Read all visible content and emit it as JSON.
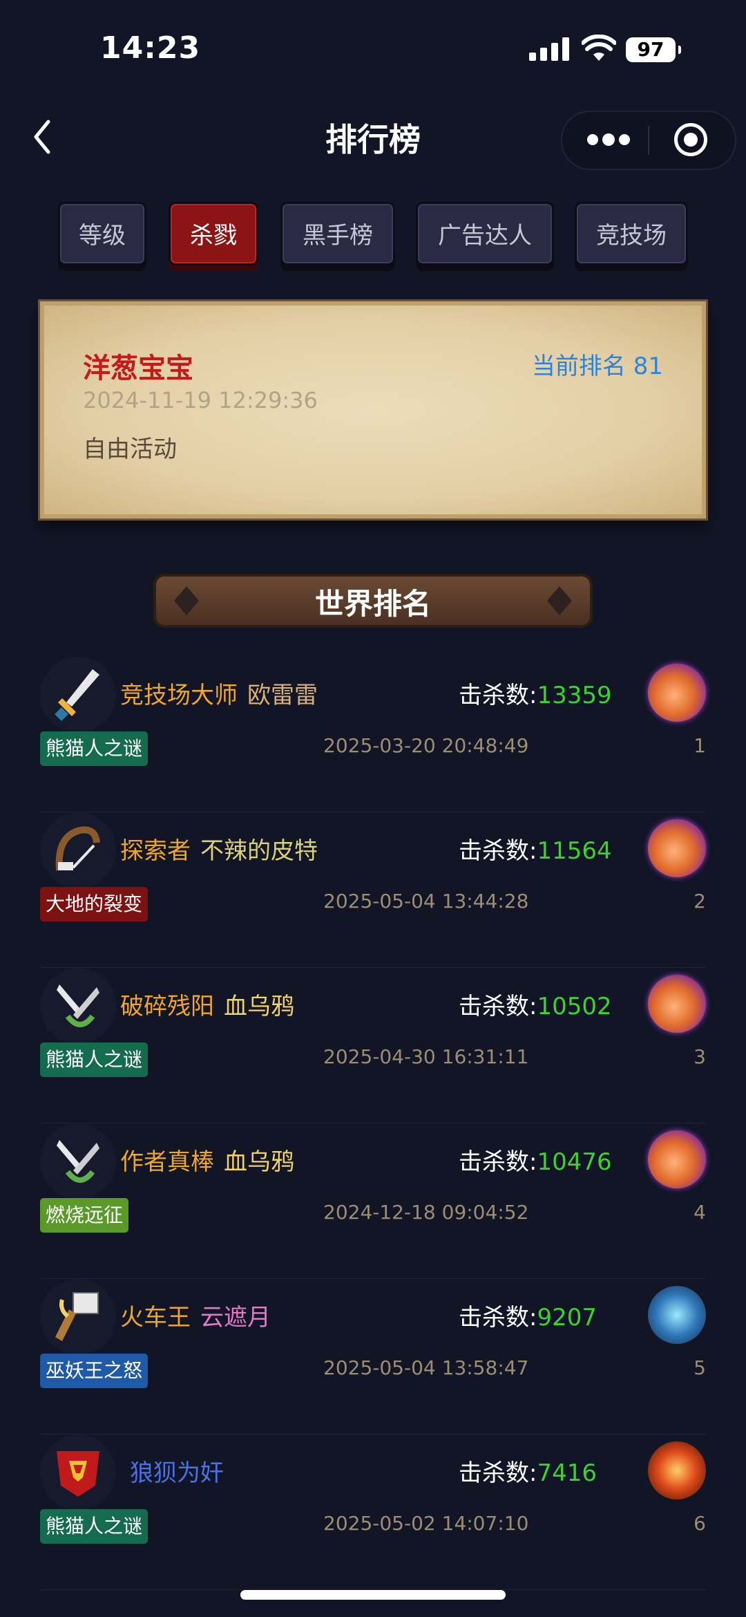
{
  "status": {
    "time": "14:23",
    "battery": "97"
  },
  "nav": {
    "title": "排行榜"
  },
  "tabs": [
    "等级",
    "杀戮",
    "黑手榜",
    "广告达人",
    "竞技场"
  ],
  "active_tab": "杀戮",
  "me": {
    "name": "洋葱宝宝",
    "rank_label": "当前排名 81",
    "time": "2024-11-19 12:29:36",
    "activity": "自由活动"
  },
  "banner": {
    "title": "世界排名"
  },
  "kills_label": "击杀数:",
  "rows": [
    {
      "title": "竞技场大师",
      "title_color": "#f0a62a",
      "name": "欧雷雷",
      "name_color": "#d8b07a",
      "kills": "13359",
      "tag": "熊猫人之谜",
      "tag_color": "#146b4d",
      "date": "2025-03-20 20:48:49",
      "rank": "1",
      "icon": "sword-icon",
      "medal": "orange"
    },
    {
      "title": "探索者",
      "title_color": "#f0a62a",
      "name": "不辣的皮特",
      "name_color": "#d9d27a",
      "kills": "11564",
      "tag": "大地的裂变",
      "tag_color": "#7d1212",
      "date": "2025-05-04 13:44:28",
      "rank": "2",
      "icon": "whip-icon",
      "medal": "orange"
    },
    {
      "title": "破碎残阳",
      "title_color": "#f0a62a",
      "name": "血乌鸦",
      "name_color": "#f2d36a",
      "kills": "10502",
      "tag": "熊猫人之谜",
      "tag_color": "#146b4d",
      "date": "2025-04-30 16:31:11",
      "rank": "3",
      "icon": "daggers-icon",
      "medal": "orange"
    },
    {
      "title": "作者真棒",
      "title_color": "#f0a62a",
      "name": "血乌鸦",
      "name_color": "#f2d36a",
      "kills": "10476",
      "tag": "燃烧远征",
      "tag_color": "#5a9a2a",
      "date": "2024-12-18 09:04:52",
      "rank": "4",
      "icon": "daggers-icon",
      "medal": "orange"
    },
    {
      "title": "火车王",
      "title_color": "#f0a62a",
      "name": "云遮月",
      "name_color": "#e07ac8",
      "kills": "9207",
      "tag": "巫妖王之怒",
      "tag_color": "#1f5aa6",
      "date": "2025-05-04 13:58:47",
      "rank": "5",
      "icon": "hammer-icon",
      "medal": "blue"
    },
    {
      "title": "",
      "title_color": "#f0a62a",
      "name": "狼狈为奸",
      "name_color": "#4a72e6",
      "kills": "7416",
      "tag": "熊猫人之谜",
      "tag_color": "#146b4d",
      "date": "2025-05-02 14:07:10",
      "rank": "6",
      "icon": "horde-banner-icon",
      "medal": "red"
    }
  ]
}
